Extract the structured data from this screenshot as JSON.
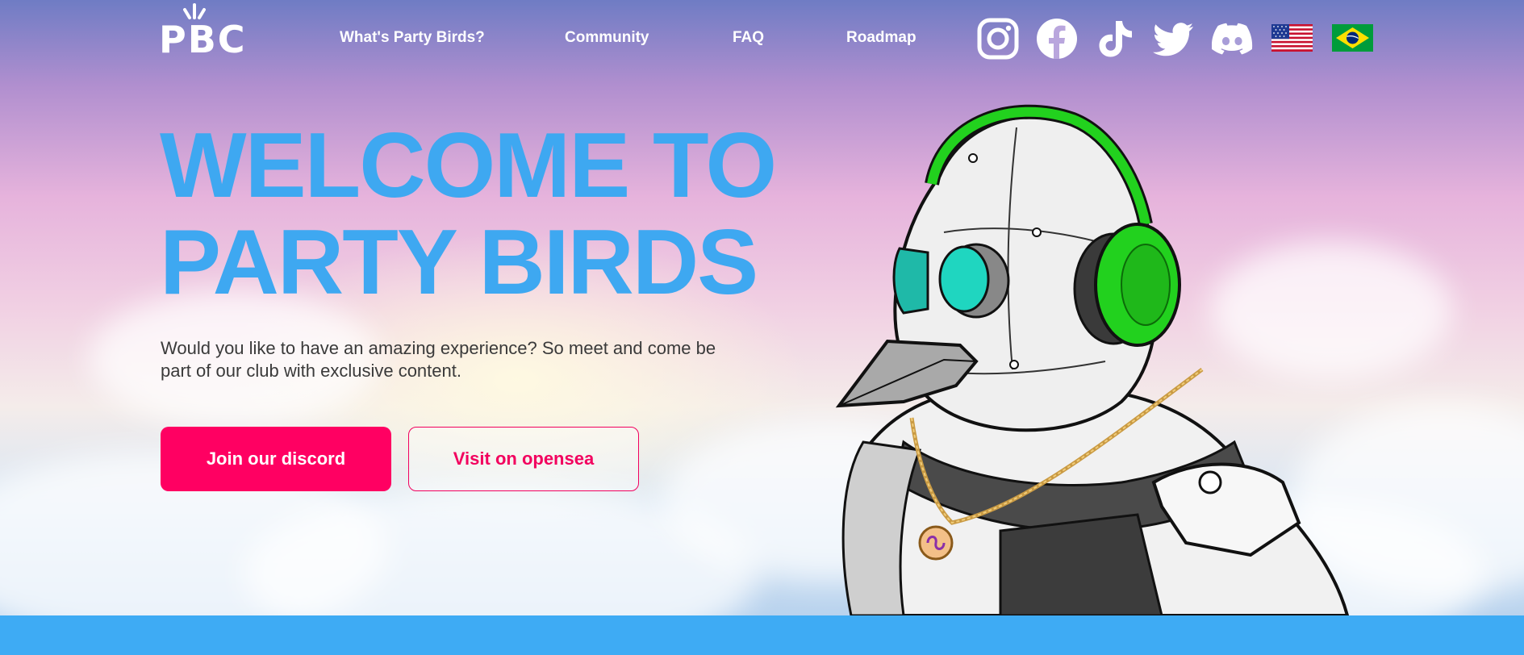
{
  "header": {
    "logo_text": "PBC",
    "nav": [
      {
        "label": "What's Party Birds?"
      },
      {
        "label": "Community"
      },
      {
        "label": "FAQ"
      },
      {
        "label": "Roadmap"
      }
    ],
    "social_icons": [
      "instagram-icon",
      "facebook-icon",
      "tiktok-icon",
      "twitter-icon",
      "discord-icon"
    ],
    "language_flags": [
      "us-flag-icon",
      "brazil-flag-icon"
    ]
  },
  "hero": {
    "title_line1": "WELCOME TO",
    "title_line2": "PARTY BIRDS",
    "subtitle": "Would you like to have an amazing experience? So meet and come be part of our club with exclusive content.",
    "primary_button": "Join our discord",
    "secondary_button": "Visit on opensea",
    "illustration": "robot-bird-with-headphones"
  },
  "colors": {
    "title_blue": "#3ea8f1",
    "button_pink": "#ff0062",
    "headphones_green": "#22d11e",
    "band_blue": "#3eabf4"
  }
}
